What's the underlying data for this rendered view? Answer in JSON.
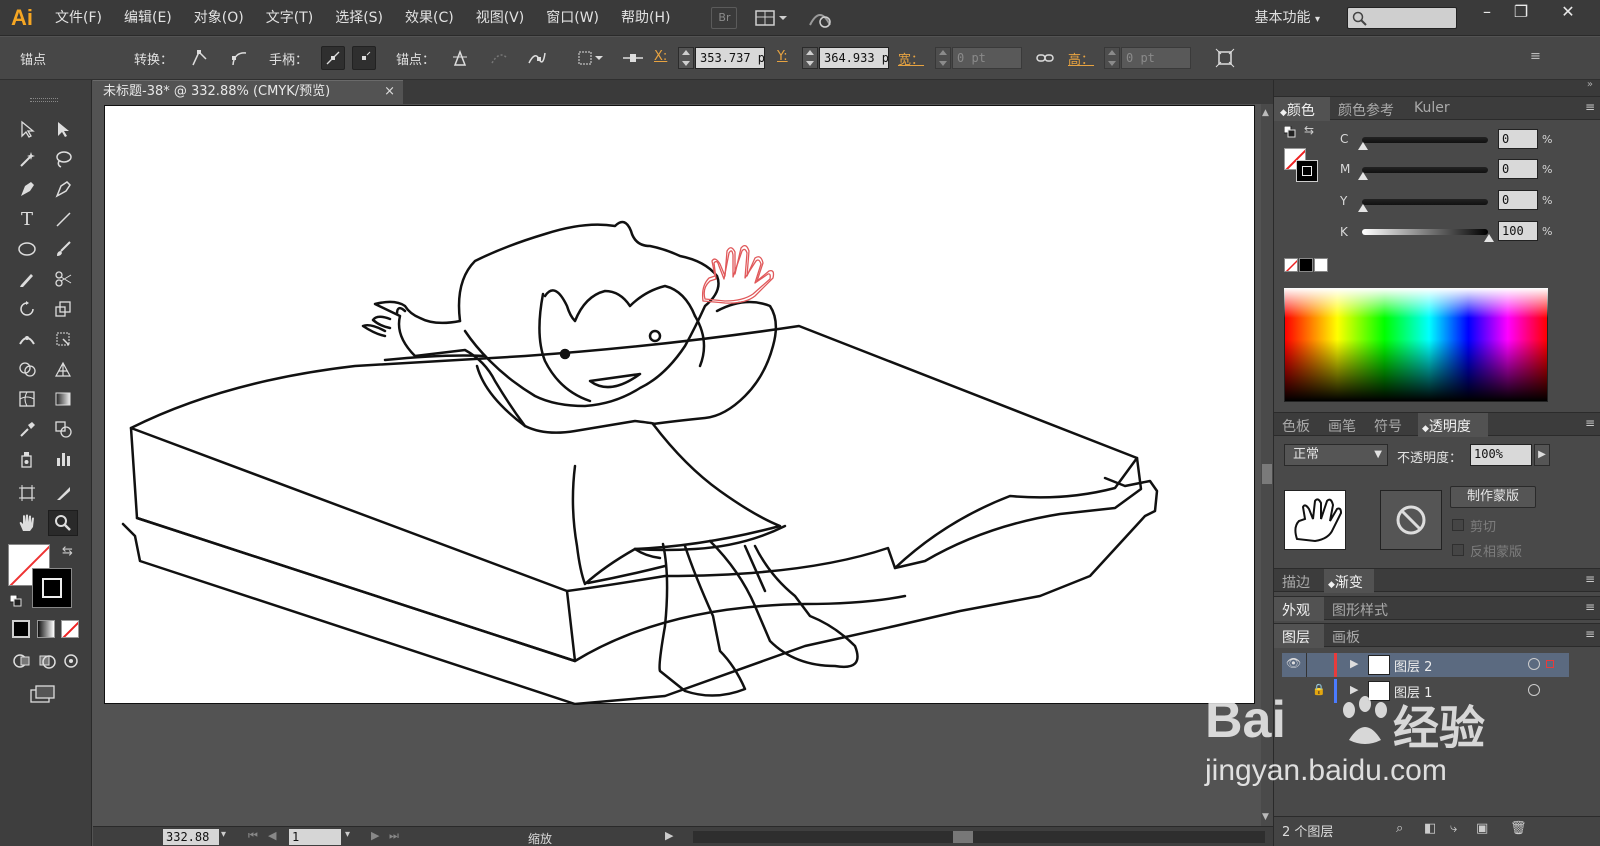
{
  "app": {
    "logo": "Ai"
  },
  "menu": [
    "文件(F)",
    "编辑(E)",
    "对象(O)",
    "文字(T)",
    "选择(S)",
    "效果(C)",
    "视图(V)",
    "窗口(W)",
    "帮助(H)"
  ],
  "menubar": {
    "bridge_label": "Br",
    "workspace": "基本功能"
  },
  "control": {
    "mode": "锚点",
    "convert_label": "转换：",
    "handles_label": "手柄：",
    "anchors_label": "锚点：",
    "x_label": "X:",
    "x_value": "353.737 p",
    "y_label": "Y:",
    "y_value": "364.933 p",
    "w_label": "宽：",
    "w_value": "0 pt",
    "h_label": "高：",
    "h_value": "0 pt"
  },
  "document": {
    "tab_title": "未标题-38* @ 332.88% (CMYK/预览)",
    "close": "×"
  },
  "status": {
    "zoom": "332.88",
    "page": "1",
    "mode": "缩放"
  },
  "color_panel": {
    "tabs": [
      "颜色",
      "颜色参考",
      "Kuler"
    ],
    "channels": [
      {
        "label": "C",
        "value": "0"
      },
      {
        "label": "M",
        "value": "0"
      },
      {
        "label": "Y",
        "value": "0"
      },
      {
        "label": "K",
        "value": "100"
      }
    ],
    "unit": "%"
  },
  "transparency_panel": {
    "tabs": [
      "色板",
      "画笔",
      "符号",
      "透明度"
    ],
    "blend_mode": "正常",
    "opacity_label": "不透明度：",
    "opacity_value": "100%",
    "make_mask": "制作蒙版",
    "clip": "剪切",
    "invert_mask": "反相蒙版"
  },
  "stroke_tabs": [
    "描边",
    "渐变"
  ],
  "appearance_tabs": [
    "外观",
    "图形样式"
  ],
  "layers_panel": {
    "tabs": [
      "图层",
      "画板"
    ],
    "layers": [
      {
        "name": "图层 2",
        "color": "#e83b3b"
      },
      {
        "name": "图层 1",
        "color": "#4a7bff"
      }
    ],
    "count": "2 个图层"
  },
  "watermark": {
    "brand": "Bai",
    "brand2": "经验",
    "url": "jingyan.baidu.com"
  },
  "colors": {
    "accent": "#e7a341",
    "selection": "#e0585a",
    "layer_selected": "#5b6a80"
  }
}
